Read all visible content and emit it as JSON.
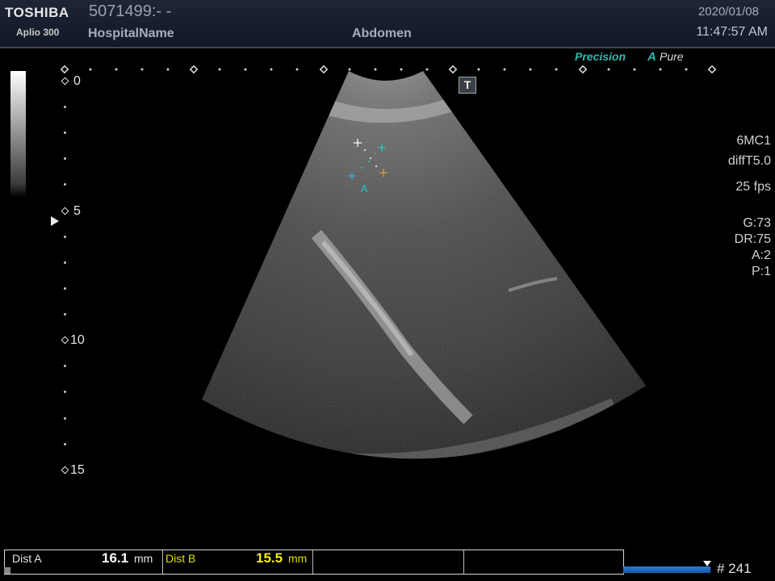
{
  "header": {
    "brand": "TOSHIBA",
    "model": "Aplio 300",
    "patient_id": "5071499:- -",
    "hospital": "HospitalName",
    "exam": "Abdomen",
    "date": "2020/01/08",
    "time": "11:47:57 AM"
  },
  "badges": {
    "precision": "Precision",
    "apure_a": "A",
    "apure": "Pure",
    "t_icon": "T"
  },
  "depth_scale": {
    "labels": [
      "0",
      "5",
      "10",
      "15"
    ]
  },
  "params": {
    "probe": "6MC1",
    "mode": "diffT5.0",
    "fps": "25 fps",
    "gain": "G:73",
    "dr": "DR:75",
    "a": "A:2",
    "p": "P:1"
  },
  "caliper": {
    "label": "A"
  },
  "measurements": {
    "dist_a_label": "Dist A",
    "dist_a_value": "16.1",
    "dist_a_unit": "mm",
    "dist_b_label": "Dist B",
    "dist_b_value": "15.5",
    "dist_b_unit": "mm"
  },
  "cine": {
    "frame_count": "# 241"
  },
  "colors": {
    "accent_teal": "#2eb7b0",
    "dist_b_yellow": "#e8e800",
    "cine_blue": "#1f6fc4"
  }
}
